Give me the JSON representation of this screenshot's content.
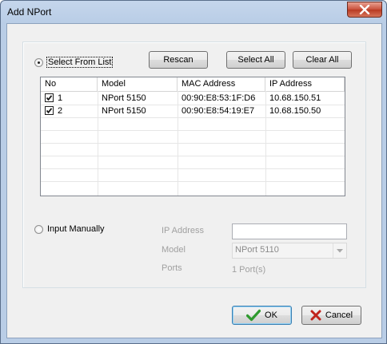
{
  "window": {
    "title": "Add NPort",
    "close_label": "close"
  },
  "select_mode": {
    "from_list_label": "Select From List",
    "manual_label": "Input Manually",
    "selected": "from_list"
  },
  "buttons": {
    "rescan": "Rescan",
    "select_all": "Select All",
    "clear_all": "Clear All",
    "ok": "OK",
    "cancel": "Cancel"
  },
  "device_list": {
    "columns": [
      "No",
      "Model",
      "MAC Address",
      "IP Address"
    ],
    "rows": [
      {
        "checked": true,
        "no": "1",
        "model": "NPort 5150",
        "mac": "00:90:E8:53:1F:D6",
        "ip": "10.68.150.51"
      },
      {
        "checked": true,
        "no": "2",
        "model": "NPort 5150",
        "mac": "00:90:E8:54:19:E7",
        "ip": "10.68.150.50"
      }
    ]
  },
  "manual": {
    "ip_label": "IP Address",
    "ip_value": "",
    "model_label": "Model",
    "model_value": "NPort 5110",
    "ports_label": "Ports",
    "ports_value": "1 Port(s)"
  },
  "colors": {
    "ok_check": "#2e9a2e",
    "cancel_x": "#c0241c",
    "title_bar": "#b9cde6"
  }
}
